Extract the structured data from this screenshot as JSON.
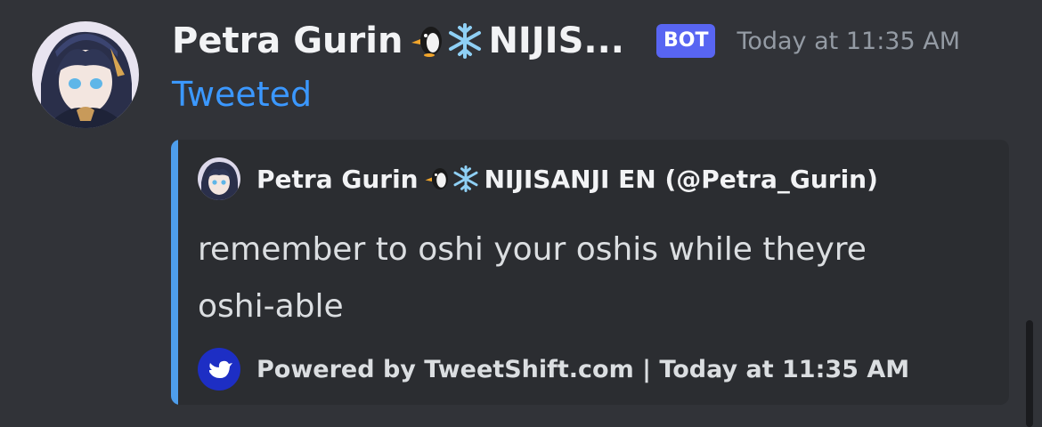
{
  "message": {
    "username": "Petra Gurin",
    "username_suffix": "NIJIS...",
    "bot_tag": "BOT",
    "timestamp": "Today at 11:35 AM",
    "action_text": "Tweeted"
  },
  "embed": {
    "author_name": "Petra Gurin",
    "author_suffix": "NIJISANJI EN (@Petra_Gurin)",
    "description_line1": "remember to oshi your oshis while theyre",
    "description_line2": "oshi-able",
    "footer": "Powered by TweetShift.com | Today at 11:35 AM",
    "accent_color": "#4e9eec"
  },
  "icons": [
    "penguin-emoji-icon",
    "snowflake-emoji-icon",
    "tweetshift-logo-icon",
    "avatar"
  ],
  "colors": {
    "background": "#313338",
    "embed_background": "#2b2d31",
    "bot_tag": "#5865f2",
    "link_blue": "#3b98ff"
  }
}
